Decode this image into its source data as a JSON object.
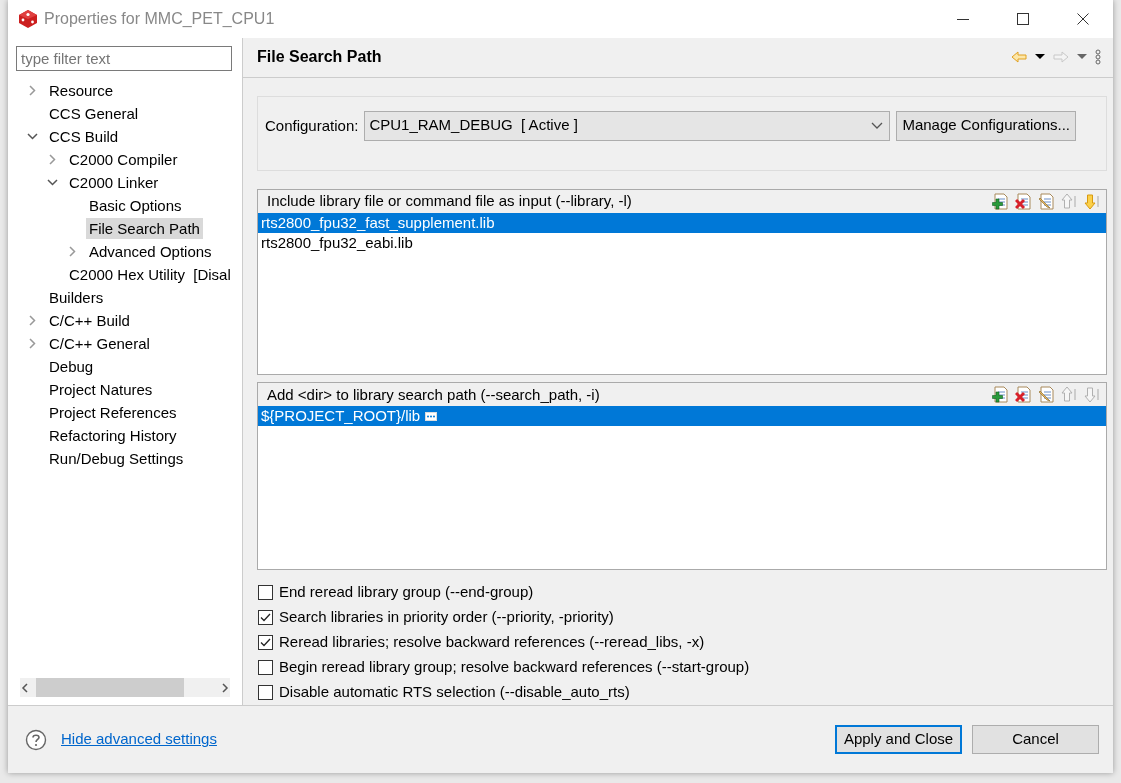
{
  "window": {
    "title": "Properties for MMC_PET_CPU1"
  },
  "filter": {
    "placeholder": "type filter text"
  },
  "tree": [
    {
      "label": "Resource",
      "expanded": false,
      "selected": false
    },
    {
      "label": "CCS General",
      "selected": false
    },
    {
      "label": "CCS Build",
      "expanded": true,
      "selected": false,
      "children": [
        {
          "label": "C2000 Compiler",
          "expanded": false,
          "selected": false
        },
        {
          "label": "C2000 Linker",
          "expanded": true,
          "selected": false,
          "children": [
            {
              "label": "Basic Options",
              "selected": false
            },
            {
              "label": "File Search Path",
              "selected": true
            },
            {
              "label": "Advanced Options",
              "expanded": false,
              "selected": false
            }
          ]
        },
        {
          "label": "C2000 Hex Utility  [Disal",
          "selected": false
        }
      ]
    },
    {
      "label": "Builders",
      "selected": false
    },
    {
      "label": "C/C++ Build",
      "expanded": false,
      "selected": false
    },
    {
      "label": "C/C++ General",
      "expanded": false,
      "selected": false
    },
    {
      "label": "Debug",
      "selected": false
    },
    {
      "label": "Project Natures",
      "selected": false
    },
    {
      "label": "Project References",
      "selected": false
    },
    {
      "label": "Refactoring History",
      "selected": false
    },
    {
      "label": "Run/Debug Settings",
      "selected": false
    }
  ],
  "page": {
    "title": "File Search Path",
    "nav": [
      {
        "kind": "back",
        "disabled": false
      },
      {
        "kind": "forward",
        "disabled": true
      }
    ],
    "configuration": {
      "label": "Configuration:",
      "value": "CPU1_RAM_DEBUG  [ Active ]",
      "button": "Manage Configurations..."
    },
    "lists": [
      {
        "title": "Include library file or command file as input (--library, -l)",
        "tools": [
          {
            "kind": "add",
            "disabled": false
          },
          {
            "kind": "remove",
            "disabled": false
          },
          {
            "kind": "edit",
            "disabled": false
          },
          {
            "kind": "up",
            "disabled": true
          },
          {
            "kind": "down",
            "disabled": false
          }
        ],
        "items": [
          {
            "text": "rts2800_fpu32_fast_supplement.lib",
            "selected": true,
            "more_button": false
          },
          {
            "text": "rts2800_fpu32_eabi.lib",
            "selected": false,
            "more_button": false
          }
        ]
      },
      {
        "title": "Add <dir> to library search path (--search_path, -i)",
        "tools": [
          {
            "kind": "add",
            "disabled": false
          },
          {
            "kind": "remove",
            "disabled": false
          },
          {
            "kind": "edit",
            "disabled": false
          },
          {
            "kind": "up",
            "disabled": true
          },
          {
            "kind": "down",
            "disabled": true
          }
        ],
        "items": [
          {
            "text": "${PROJECT_ROOT}/lib",
            "selected": true,
            "more_button": true
          }
        ]
      }
    ],
    "options": [
      {
        "label": "End reread library group (--end-group)",
        "checked": false
      },
      {
        "label": "Search libraries in priority order (--priority, -priority)",
        "checked": true
      },
      {
        "label": "Reread libraries; resolve backward references (--reread_libs, -x)",
        "checked": true
      },
      {
        "label": "Begin reread library group; resolve backward references (--start-group)",
        "checked": false
      },
      {
        "label": "Disable automatic RTS selection (--disable_auto_rts)",
        "checked": false
      }
    ]
  },
  "footer": {
    "link": "Hide advanced settings",
    "buttons": [
      {
        "label": "Apply and Close",
        "default": true
      },
      {
        "label": "Cancel",
        "default": false
      }
    ]
  }
}
